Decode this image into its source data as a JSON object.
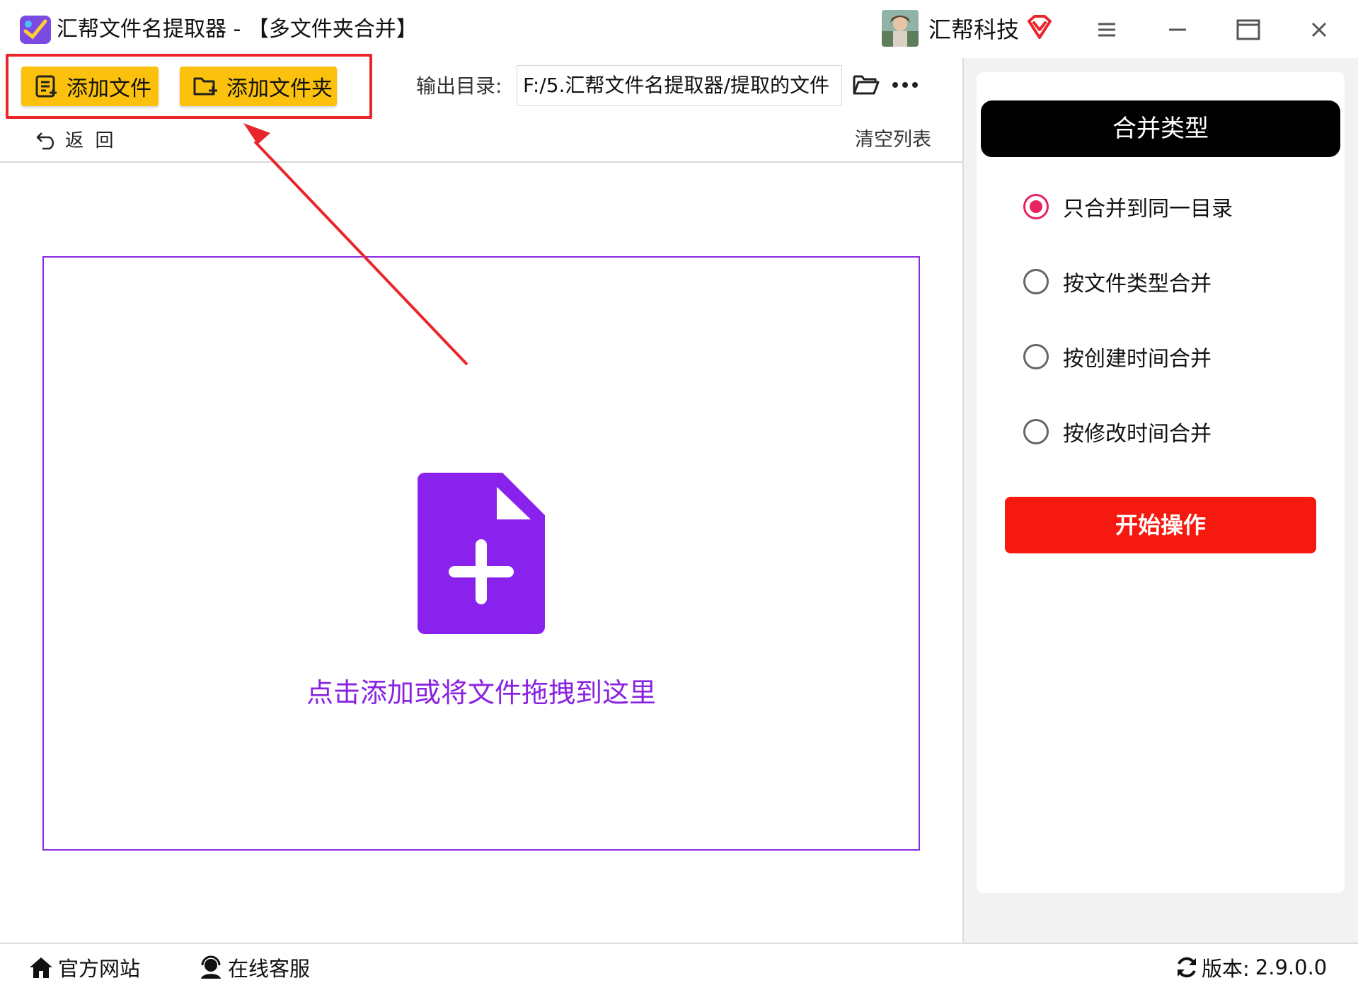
{
  "window": {
    "title": "汇帮文件名提取器 - 【多文件夹合并】",
    "user_name": "汇帮科技"
  },
  "toolbar": {
    "add_file_label": "添加文件",
    "add_folder_label": "添加文件夹",
    "output_label": "输出目录:",
    "output_path": "F:/5.汇帮文件名提取器/提取的文件",
    "back_label": "返  回",
    "clear_label": "清空列表"
  },
  "drop_zone": {
    "hint": "点击添加或将文件拖拽到这里"
  },
  "merge_panel": {
    "title": "合并类型",
    "options": [
      {
        "label": "只合并到同一目录",
        "checked": true
      },
      {
        "label": "按文件类型合并",
        "checked": false
      },
      {
        "label": "按创建时间合并",
        "checked": false
      },
      {
        "label": "按修改时间合并",
        "checked": false
      }
    ],
    "start_label": "开始操作"
  },
  "footer": {
    "website_label": "官方网站",
    "support_label": "在线客服",
    "version_label": "版本:",
    "version_value": "2.9.0.0"
  },
  "colors": {
    "accent_yellow": "#fcc10c",
    "drop_purple": "#8a2be2",
    "start_red": "#f5190f",
    "radio_pink": "#e8235e",
    "highlight_red": "#e8262b"
  }
}
